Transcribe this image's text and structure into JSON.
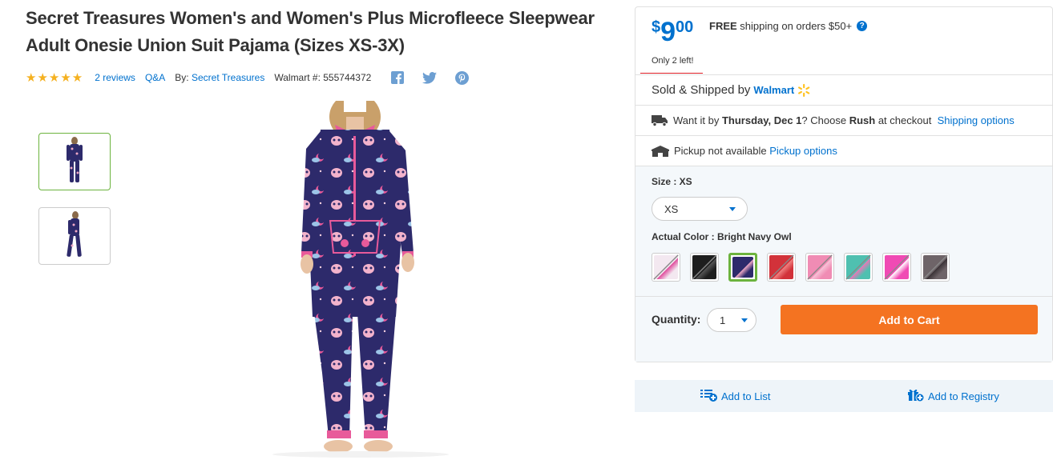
{
  "product": {
    "title": "Secret Treasures Women's and Women's Plus Microfleece Sleepwear Adult Onesie Union Suit Pajama (Sizes XS-3X)",
    "stars": "★★★★★",
    "reviews": "2 reviews",
    "qa": "Q&A",
    "by_label": "By:",
    "brand": "Secret Treasures",
    "walmart_label": "Walmart #:",
    "walmart_number": "555744372"
  },
  "social": {
    "icons": [
      "facebook-icon",
      "twitter-icon",
      "pinterest-icon"
    ]
  },
  "buybox": {
    "price_currency": "$",
    "price_whole": "9",
    "price_cents": "00",
    "free_shipping_bold": "FREE",
    "free_shipping_text": "shipping on orders $50+",
    "only_left": "Only 2 left!",
    "sold_by_text": "Sold & Shipped by",
    "sold_by_name": "Walmart",
    "ship_prefix": "Want it by",
    "ship_date": "Thursday, Dec 1",
    "ship_mid": "? Choose",
    "ship_rush": "Rush",
    "ship_suffix": "at checkout",
    "shipping_options": "Shipping options",
    "pickup_text": "Pickup not available",
    "pickup_options": "Pickup options",
    "size_label": "Size : XS",
    "size_value": "XS",
    "color_label": "Actual Color : Bright Navy Owl",
    "quantity_label": "Quantity:",
    "quantity_value": "1",
    "add_to_cart": "Add to Cart"
  },
  "swatches": [
    {
      "name": "white-print",
      "color": "#f3e8f0",
      "accent": "#e04a9c",
      "available": false
    },
    {
      "name": "black",
      "color": "#1e1e1e",
      "accent": "#555555",
      "available": false
    },
    {
      "name": "bright-navy-owl",
      "color": "#2d2a6b",
      "accent": "#f0a9c6",
      "available": true
    },
    {
      "name": "red-plaid",
      "color": "#d2323a",
      "accent": "#f08080",
      "available": false
    },
    {
      "name": "pink",
      "color": "#f08cb4",
      "accent": "#f7c2d7",
      "available": false
    },
    {
      "name": "teal-pink",
      "color": "#4fc0b0",
      "accent": "#e878b8",
      "available": false
    },
    {
      "name": "hot-pink",
      "color": "#f04ab4",
      "accent": "#ffffff",
      "available": false
    },
    {
      "name": "leopard",
      "color": "#6e6468",
      "accent": "#3a3236",
      "available": false
    }
  ],
  "list_bar": {
    "add_to_list": "Add to List",
    "add_to_registry": "Add to Registry"
  },
  "colors": {
    "link": "#0071ce",
    "star": "#f5b120",
    "cta": "#f47321",
    "selected": "#6cb33e"
  }
}
